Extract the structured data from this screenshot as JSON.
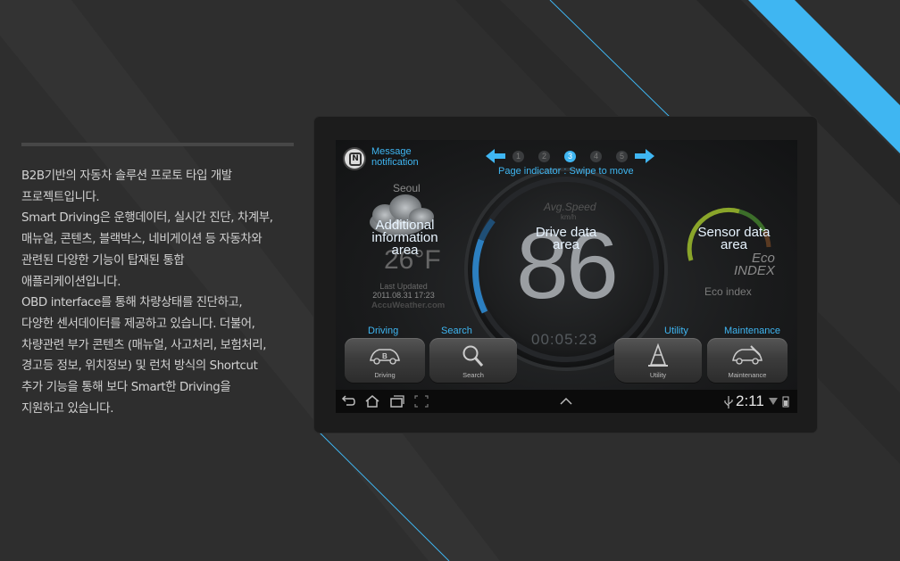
{
  "description": [
    "B2B기반의 자동차 솔루션 프로토 타입 개발",
    "프로젝트입니다.",
    "Smart Driving은 운행데이터, 실시간 진단, 차계부,",
    "매뉴얼, 콘텐츠, 블랙박스, 네비게이션 등 자동차와",
    "관련된 다양한 기능이 탑재된 통합",
    "애플리케이션입니다.",
    "OBD interface를 통해 차량상태를 진단하고,",
    "다양한 센서데이터를 제공하고 있습니다. 더불어,",
    "차량관련 부가 콘텐츠 (매뉴얼, 사고처리, 보험처리,",
    "경고등 정보, 위치정보) 및 런처 방식의 Shortcut",
    "추가 기능을 통해 보다 Smart한 Driving을",
    "지원하고 있습니다."
  ],
  "app": {
    "message_line1": "Message",
    "message_line2": "notification",
    "pages": [
      "1",
      "2",
      "3",
      "4",
      "5"
    ],
    "active_page": 3,
    "page_indicator": "Page indicator : Swipe to move",
    "weather": {
      "city": "Seoul",
      "temperature": "26°F",
      "last_updated_label": "Last Updated",
      "last_updated": "2011.08.31 17:23",
      "provider": "AccuWeather.com"
    },
    "areas": {
      "additional": [
        "Additional",
        "information",
        "area"
      ],
      "drive": [
        "Drive data",
        "area"
      ],
      "sensor": [
        "Sensor data",
        "area"
      ]
    },
    "speed": {
      "label": "Avg.Speed",
      "unit": "km/h",
      "value": "86",
      "timer": "00:05:23"
    },
    "eco": {
      "line1": "Eco",
      "line2": "INDEX",
      "label": "Eco index"
    },
    "buttons": [
      {
        "label": "Driving",
        "caption": "Driving"
      },
      {
        "label": "Search",
        "caption": "Search"
      },
      {
        "label": "Utility",
        "caption": "Utility"
      },
      {
        "label": "Maintenance",
        "caption": "Maintenance"
      }
    ],
    "statusbar": {
      "time": "2:11"
    }
  },
  "colors": {
    "accent": "#3fb6f2",
    "background": "#2e2e2e"
  }
}
